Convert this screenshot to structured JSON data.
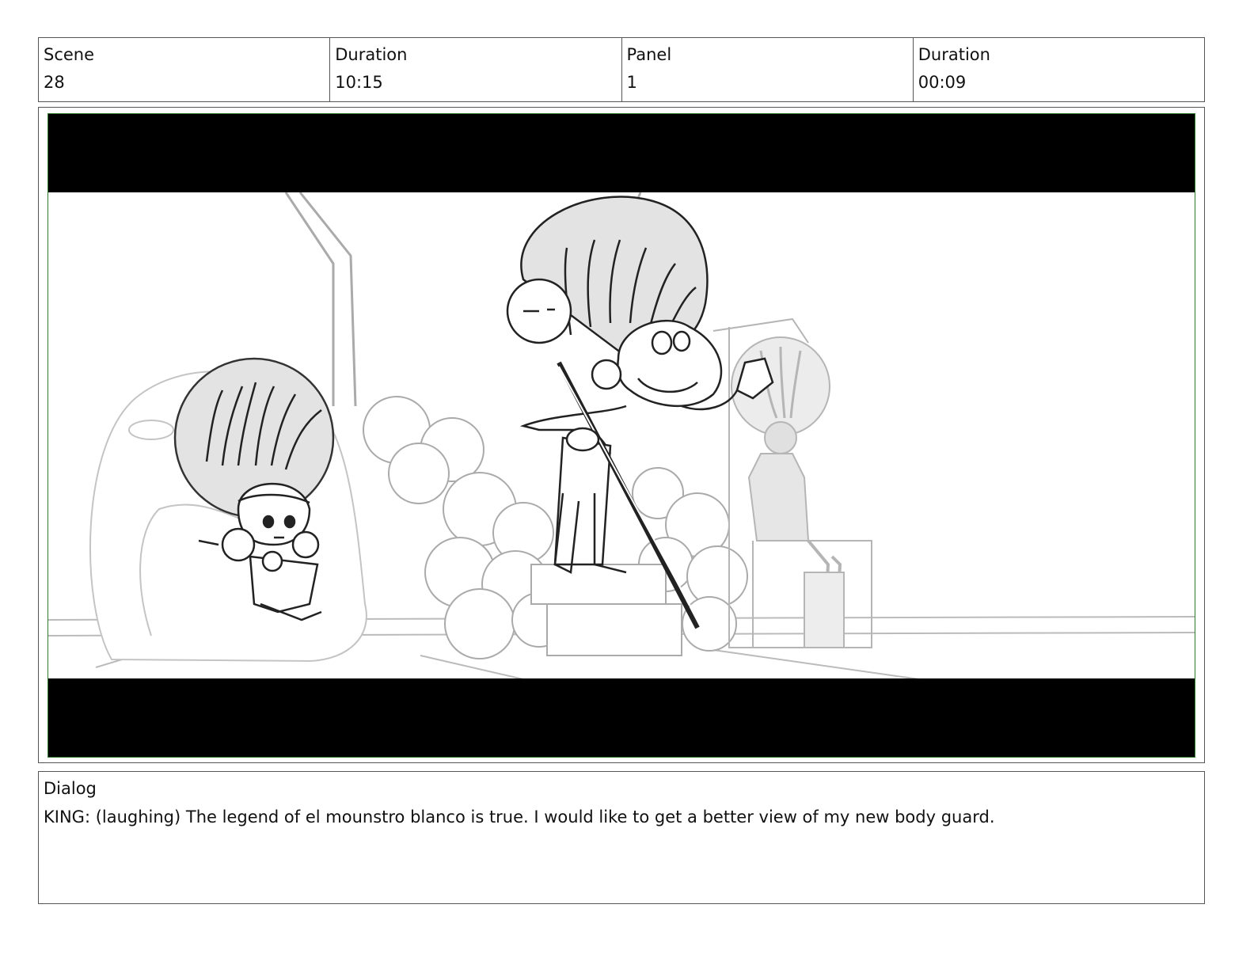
{
  "header": {
    "scene_label": "Scene",
    "scene_value": "28",
    "duration_label": "Duration",
    "duration_value": "10:15",
    "panel_label": "Panel",
    "panel_value": "1",
    "panel_duration_label": "Duration",
    "panel_duration_value": "00:09"
  },
  "dialog": {
    "label": "Dialog",
    "text": "KING: (laughing) The legend of el mounstro blanco is true. I would like to get a better view of my new body guard."
  },
  "colors": {
    "frame_border": "#2f7a2f",
    "letterbox": "#000000",
    "sketch_line": "#222222",
    "sketch_fill": "#e3e3e3"
  }
}
